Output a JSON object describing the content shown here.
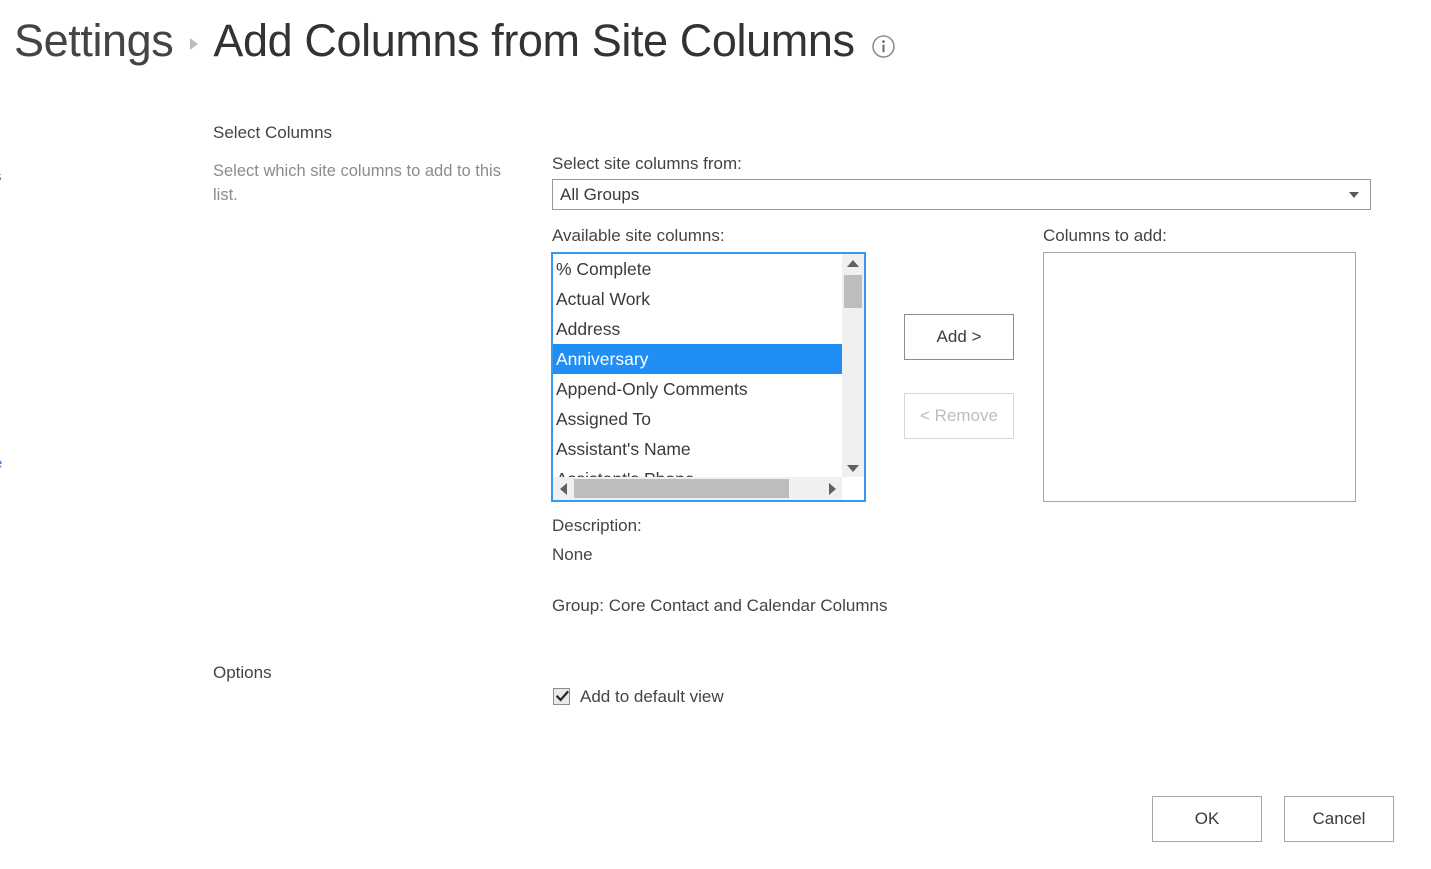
{
  "header": {
    "breadcrumb_parent": "Settings",
    "breadcrumb_separator": "chevron-right",
    "page_title": "Add Columns from Site Columns",
    "info_icon": "info-circle-icon"
  },
  "left_column": {
    "select_columns_heading": "Select Columns",
    "select_columns_description": "Select which site columns to add to this list.",
    "options_heading": "Options"
  },
  "select_group": {
    "label": "Select site columns from:",
    "selected_value": "All Groups",
    "options": [
      "All Groups"
    ],
    "arrow_icon": "chevron-down-icon"
  },
  "available": {
    "label": "Available site columns:",
    "items": [
      "% Complete",
      "Actual Work",
      "Address",
      "Anniversary",
      "Append-Only Comments",
      "Assigned To",
      "Assistant's Name",
      "Assistant's Phone"
    ],
    "selected_item": "Anniversary",
    "selected_index": 3,
    "vertical_scrollbar": {
      "up_arrow_icon": "triangle-up-icon",
      "down_arrow_icon": "triangle-down-icon"
    },
    "horizontal_scrollbar": {
      "left_arrow_icon": "triangle-left-icon",
      "right_arrow_icon": "triangle-right-icon"
    }
  },
  "transfer_buttons": {
    "add_label": "Add >",
    "remove_label": "< Remove",
    "add_enabled": true,
    "remove_enabled": false
  },
  "columns_to_add": {
    "label": "Columns to add:",
    "items": []
  },
  "details": {
    "description_label": "Description:",
    "description_value": "None",
    "group_line": "Group: Core Contact and Calendar Columns"
  },
  "options": {
    "add_to_default_view_label": "Add to default view",
    "add_to_default_view_checked": true,
    "check_icon": "checkmark-icon"
  },
  "footer": {
    "ok_label": "OK",
    "cancel_label": "Cancel"
  },
  "colors": {
    "selection_blue": "#1f8ff5",
    "focus_border_blue": "#3399f3",
    "text": "#444444",
    "muted_text": "#8c8c8c",
    "border_gray": "#a6a6a6",
    "disabled_gray": "#bdbdbd"
  },
  "edge_remnants": {
    "top_fragment": "s",
    "bottom_fragment": "e"
  }
}
